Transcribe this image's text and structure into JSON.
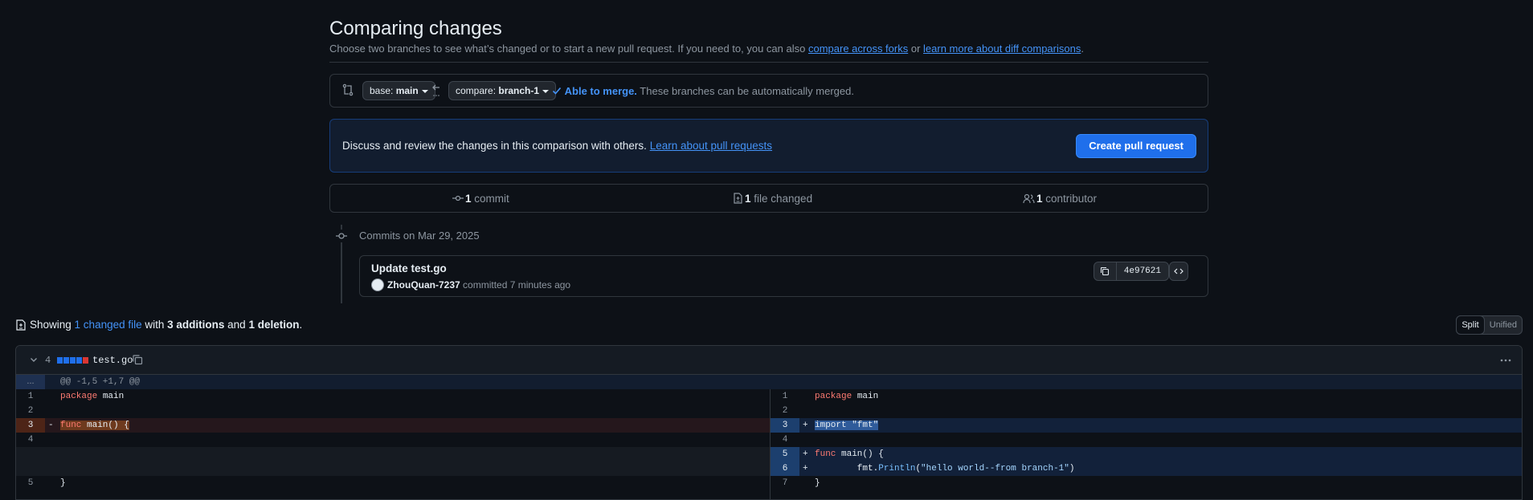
{
  "header": {
    "title": "Comparing changes",
    "subtitle_prefix": "Choose two branches to see what’s changed or to start a new pull request. If you need to, you can also ",
    "link_forks": "compare across forks",
    "subtitle_or": " or ",
    "link_learn_diff": "learn more about diff comparisons",
    "subtitle_end": "."
  },
  "range": {
    "base_prefix": "base: ",
    "base_branch": "main",
    "compare_prefix": "compare: ",
    "compare_branch": "branch-1",
    "merge_ok": "Able to merge.",
    "merge_note": " These branches can be automatically merged."
  },
  "discuss": {
    "text": "Discuss and review the changes in this comparison with others. ",
    "link": "Learn about pull requests",
    "button": "Create pull request"
  },
  "stats": {
    "commits_count": "1",
    "commits_label": " commit",
    "files_count": "1",
    "files_label": " file changed",
    "contributors_count": "1",
    "contributors_label": " contributor"
  },
  "commits": {
    "date_heading": "Commits on Mar 29, 2025",
    "items": [
      {
        "message": "Update test.go",
        "author": "ZhouQuan-7237",
        "meta": " committed 7 minutes ago",
        "sha": "4e97621"
      }
    ]
  },
  "summary": {
    "prefix": "Showing ",
    "changed_link": "1 changed file",
    "with": " with ",
    "additions": "3 additions",
    "and": " and ",
    "deletions": "1 deletion",
    "end": "."
  },
  "view_toggle": {
    "split": "Split",
    "unified": "Unified",
    "active": "Split"
  },
  "file": {
    "change_count": "4",
    "name": "test.go",
    "hunk_expand": "...",
    "hunk_header": "@@ -1,5 +1,7 @@",
    "diffstat_colors": [
      "#1f6feb",
      "#1f6feb",
      "#1f6feb",
      "#1f6feb",
      "#da3633"
    ]
  },
  "diff_left": [
    {
      "ln": "1",
      "mk": "",
      "code": "package main",
      "type": "ctx"
    },
    {
      "ln": "2",
      "mk": "",
      "code": "",
      "type": "ctx"
    },
    {
      "ln": "3",
      "mk": "-",
      "code": "func main() {",
      "type": "del"
    },
    {
      "ln": "4",
      "mk": "",
      "code": "",
      "type": "ctx"
    },
    {
      "ln": "",
      "mk": "",
      "code": "",
      "type": "empty"
    },
    {
      "ln": "",
      "mk": "",
      "code": "",
      "type": "empty"
    },
    {
      "ln": "5",
      "mk": "",
      "code": "}",
      "type": "ctx"
    }
  ],
  "diff_right": [
    {
      "ln": "1",
      "mk": "",
      "code": "package main",
      "type": "ctx"
    },
    {
      "ln": "2",
      "mk": "",
      "code": "",
      "type": "ctx"
    },
    {
      "ln": "3",
      "mk": "+",
      "code": "import \"fmt\"",
      "type": "add"
    },
    {
      "ln": "4",
      "mk": "",
      "code": "",
      "type": "ctx"
    },
    {
      "ln": "5",
      "mk": "+",
      "code": "func main() {",
      "type": "add"
    },
    {
      "ln": "6",
      "mk": "+",
      "code": "        fmt.Println(\"hello world--from branch-1\")",
      "type": "add"
    },
    {
      "ln": "7",
      "mk": "",
      "code": "}",
      "type": "ctx"
    }
  ]
}
